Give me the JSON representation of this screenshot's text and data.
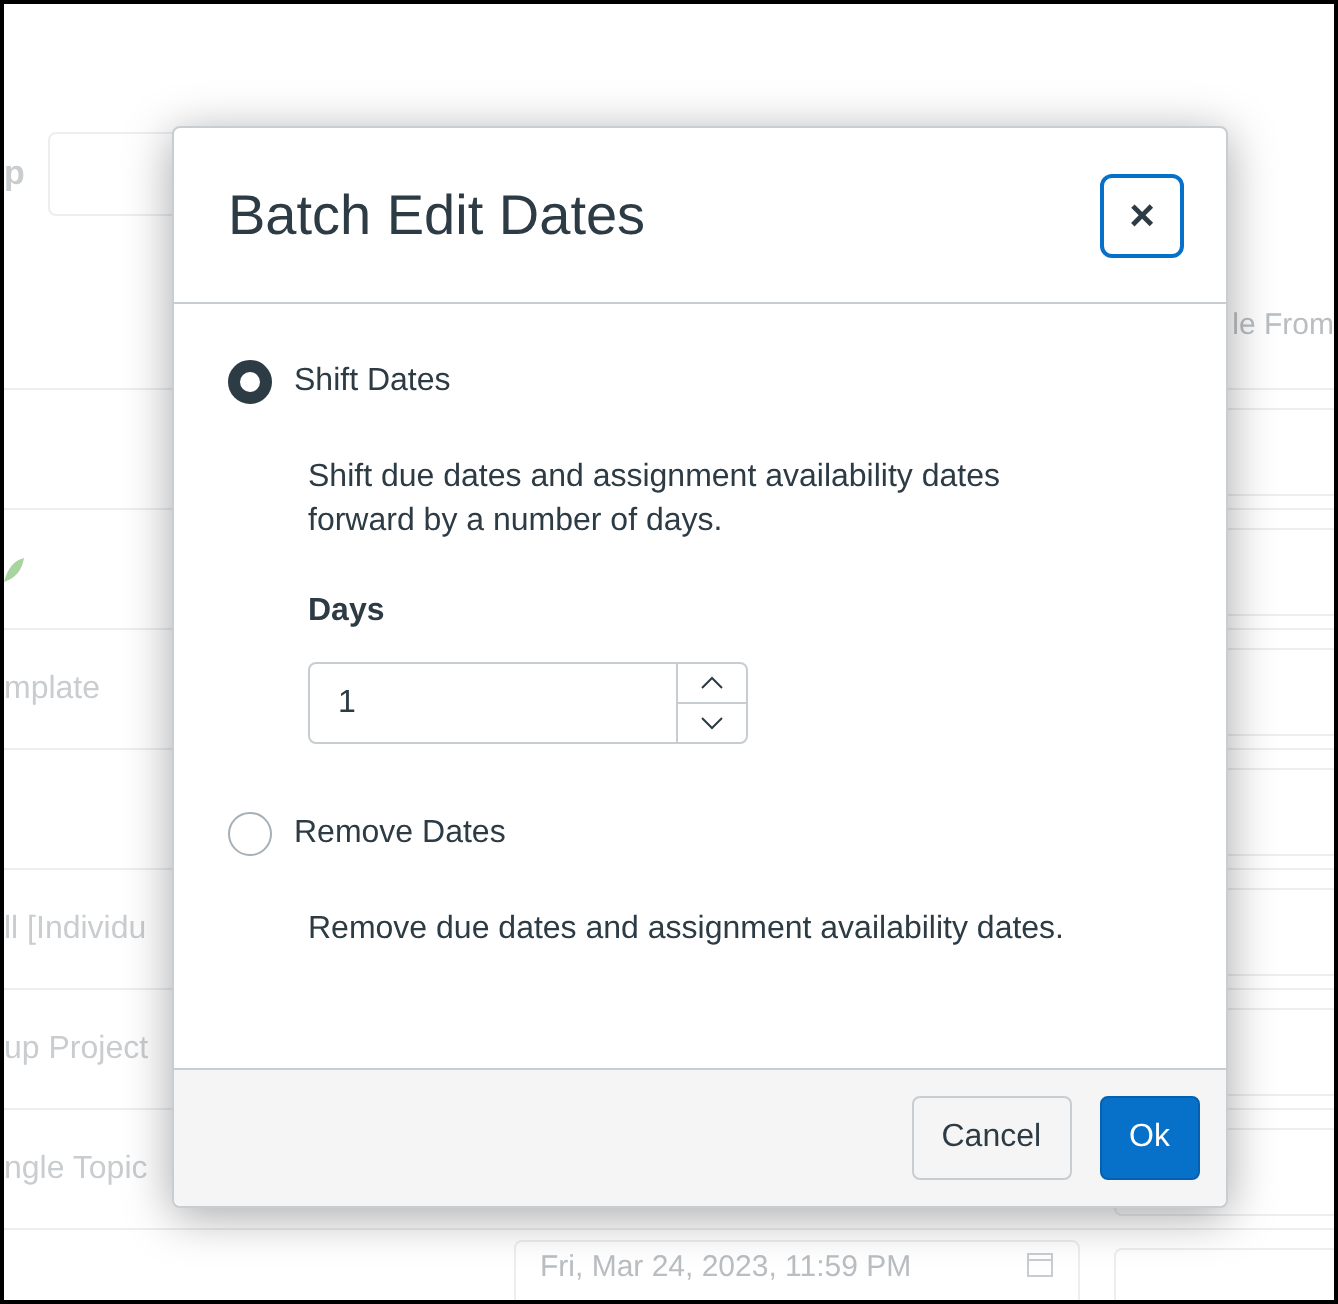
{
  "background": {
    "header_label": "p",
    "column_header": "le From",
    "rows": [
      {
        "kind": "blank"
      },
      {
        "kind": "leaf"
      },
      {
        "kind": "text",
        "text": "mplate"
      },
      {
        "kind": "blank"
      },
      {
        "kind": "text",
        "text": "ll [Individu"
      },
      {
        "kind": "text",
        "text": "up Project"
      },
      {
        "kind": "text",
        "text": "ngle Topic"
      },
      {
        "kind": "date",
        "date": "Fri, Mar 24, 2023, 11:59 PM"
      }
    ]
  },
  "dialog": {
    "title": "Batch Edit Dates",
    "close": "×",
    "options": [
      {
        "label": "Shift Dates",
        "selected": true,
        "description": "Shift due dates and assignment availability dates forward by a number of days.",
        "field": {
          "label": "Days",
          "value": "1"
        }
      },
      {
        "label": "Remove Dates",
        "selected": false,
        "description": "Remove due dates and assignment availability dates."
      }
    ],
    "buttons": [
      {
        "label": "Cancel",
        "kind": "secondary"
      },
      {
        "label": "Ok",
        "kind": "primary"
      }
    ]
  }
}
